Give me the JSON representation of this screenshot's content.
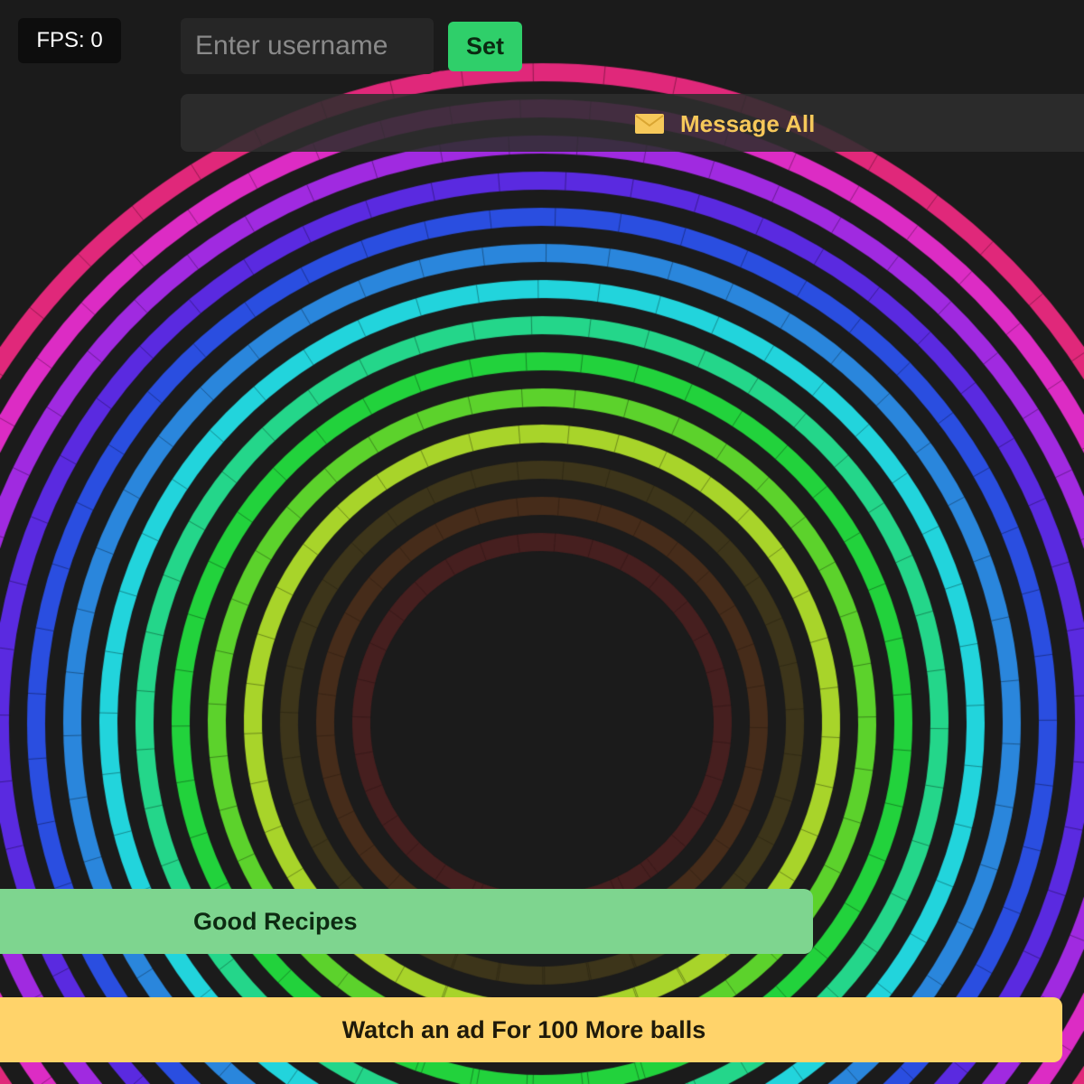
{
  "hud": {
    "fps_label": "FPS: 0"
  },
  "username": {
    "placeholder": "Enter username",
    "value": "",
    "set_label": "Set"
  },
  "message_bar": {
    "icon": "envelope-icon",
    "label": "Message All"
  },
  "recipes": {
    "label": "Good Recipes"
  },
  "ad": {
    "label": "Watch an ad For 100 More balls"
  },
  "colors": {
    "background": "#1b1b1b",
    "set_button": "#2fcf6a",
    "message_text": "#f6c85a",
    "recipes_button": "#7ed58f",
    "ad_button": "#ffd36a"
  },
  "rings": [
    {
      "color": "#6a2222",
      "opacity": 0.55
    },
    {
      "color": "#6a3a1a",
      "opacity": 0.55
    },
    {
      "color": "#5a4a1a",
      "opacity": 0.55
    },
    {
      "color": "#a8d42a",
      "opacity": 1
    },
    {
      "color": "#5cd22c",
      "opacity": 1
    },
    {
      "color": "#22d23c",
      "opacity": 1
    },
    {
      "color": "#24d68a",
      "opacity": 1
    },
    {
      "color": "#22d4dc",
      "opacity": 1
    },
    {
      "color": "#2a86dc",
      "opacity": 1
    },
    {
      "color": "#2a4ee0",
      "opacity": 1
    },
    {
      "color": "#5a2ae0",
      "opacity": 1
    },
    {
      "color": "#a02ae0",
      "opacity": 1
    },
    {
      "color": "#dc2cc4",
      "opacity": 1
    },
    {
      "color": "#e0287a",
      "opacity": 1
    }
  ]
}
